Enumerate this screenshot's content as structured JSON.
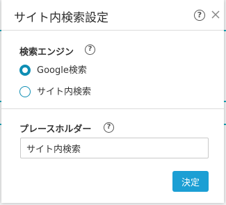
{
  "dialog": {
    "title": "サイト内検索設定",
    "help_icon": "help-circle-icon",
    "close_icon": "close-x-icon"
  },
  "search_engine": {
    "label": "検索エンジン",
    "help_icon": "help-circle-icon",
    "options": [
      {
        "label": "Google検索",
        "checked": true
      },
      {
        "label": "サイト内検索",
        "checked": false
      }
    ]
  },
  "placeholder_section": {
    "label": "プレースホルダー",
    "help_icon": "help-circle-icon",
    "input_value": "サイト内検索"
  },
  "submit_button": {
    "label": "決定"
  },
  "colors": {
    "accent": "#1b9fd4",
    "radio": "#0f8eb4",
    "background_line": "#1aa5b7"
  }
}
